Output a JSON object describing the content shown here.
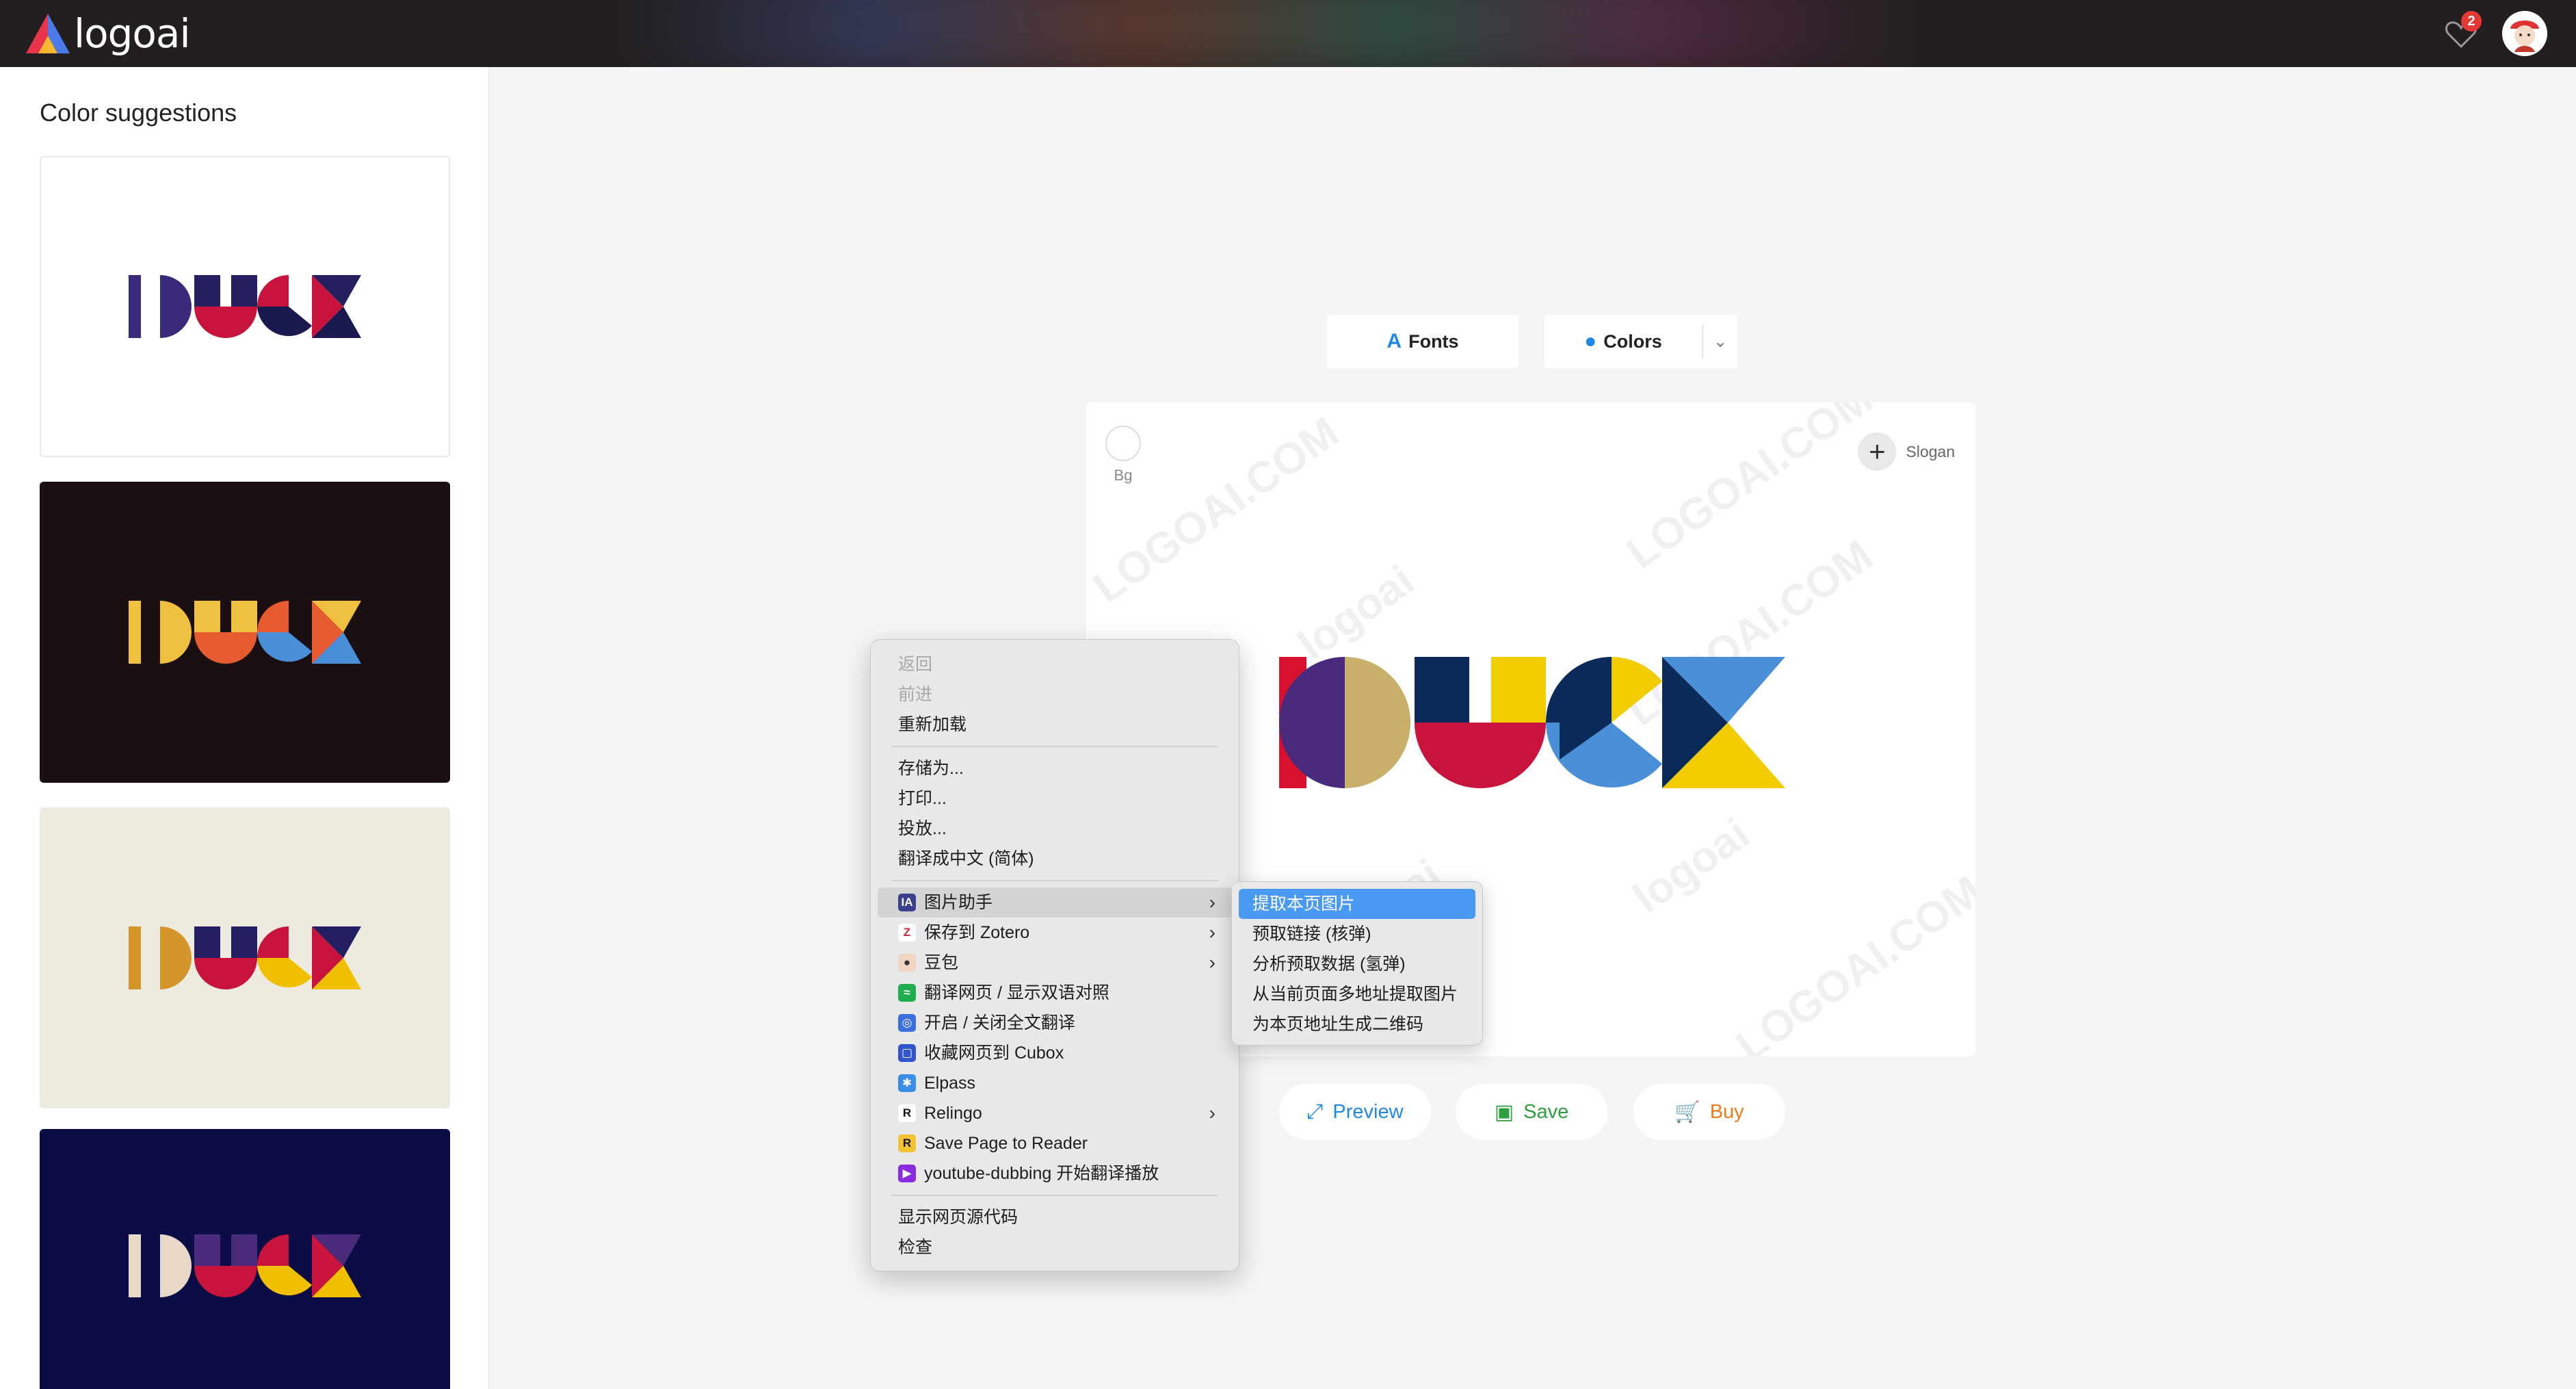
{
  "header": {
    "brand": "logoai",
    "favorites_count": "2",
    "icons": {
      "logo": "logoai-logo-icon",
      "favorites": "heart-icon",
      "avatar": "user-avatar"
    }
  },
  "sidebar": {
    "title": "Color suggestions",
    "suggestions": [
      {
        "name": "DUCK",
        "bg": "#ffffff",
        "colors": [
          "#3b2a7a",
          "#24205f",
          "#c8143c",
          "#1a1a50"
        ]
      },
      {
        "name": "DUCK",
        "bg": "#1a1011",
        "colors": [
          "#f0c040",
          "#f0c040",
          "#e65c30",
          "#4a90d8"
        ]
      },
      {
        "name": "DUCK",
        "bg": "#edeae0",
        "colors": [
          "#d4952a",
          "#241f62",
          "#c8143c",
          "#f0c000"
        ]
      },
      {
        "name": "DUCK",
        "bg": "#0b0b45",
        "colors": [
          "#e8d8c8",
          "#4a2a7a",
          "#c8143c",
          "#f0c000"
        ]
      }
    ]
  },
  "toolbar": {
    "fonts_label": "Fonts",
    "colors_label": "Colors"
  },
  "canvas": {
    "bg_label": "Bg",
    "slogan_label": "Slogan",
    "logo_text": "DUCK",
    "watermark": "LOGOAI.COM",
    "watermark_brand": "logoai",
    "logo_colors": [
      "#d8112e",
      "#4a2a7a",
      "#c8b06a",
      "#0a2a5a",
      "#c8143c",
      "#0a2a5a",
      "#f0cc00",
      "#4a90d8",
      "#0a2a5a",
      "#4a90d8",
      "#f0cc00"
    ]
  },
  "actions": {
    "preview_label": "Preview",
    "save_label": "Save",
    "buy_label": "Buy",
    "preview_color": "#1e88e5",
    "save_color": "#2e9e3e",
    "buy_color": "#f07a1a"
  },
  "context_menu": {
    "back": "返回",
    "forward": "前进",
    "reload": "重新加载",
    "save_as": "存储为...",
    "print": "打印...",
    "cast": "投放...",
    "translate": "翻译成中文 (简体)",
    "image_assistant": "图片助手",
    "zotero": "保存到 Zotero",
    "doubao": "豆包",
    "bilingual": "翻译网页 / 显示双语对照",
    "fulltext": "开启 / 关闭全文翻译",
    "cubox": "收藏网页到 Cubox",
    "elpass": "Elpass",
    "relingo": "Relingo",
    "reader": "Save Page to Reader",
    "youtube": "youtube-dubbing 开始翻译播放",
    "view_source": "显示网页源代码",
    "inspect": "检查"
  },
  "submenu": {
    "items": [
      "提取本页图片",
      "预取链接 (核弹)",
      "分析预取数据 (氢弹)",
      "从当前页面多地址提取图片",
      "为本页地址生成二维码"
    ]
  }
}
